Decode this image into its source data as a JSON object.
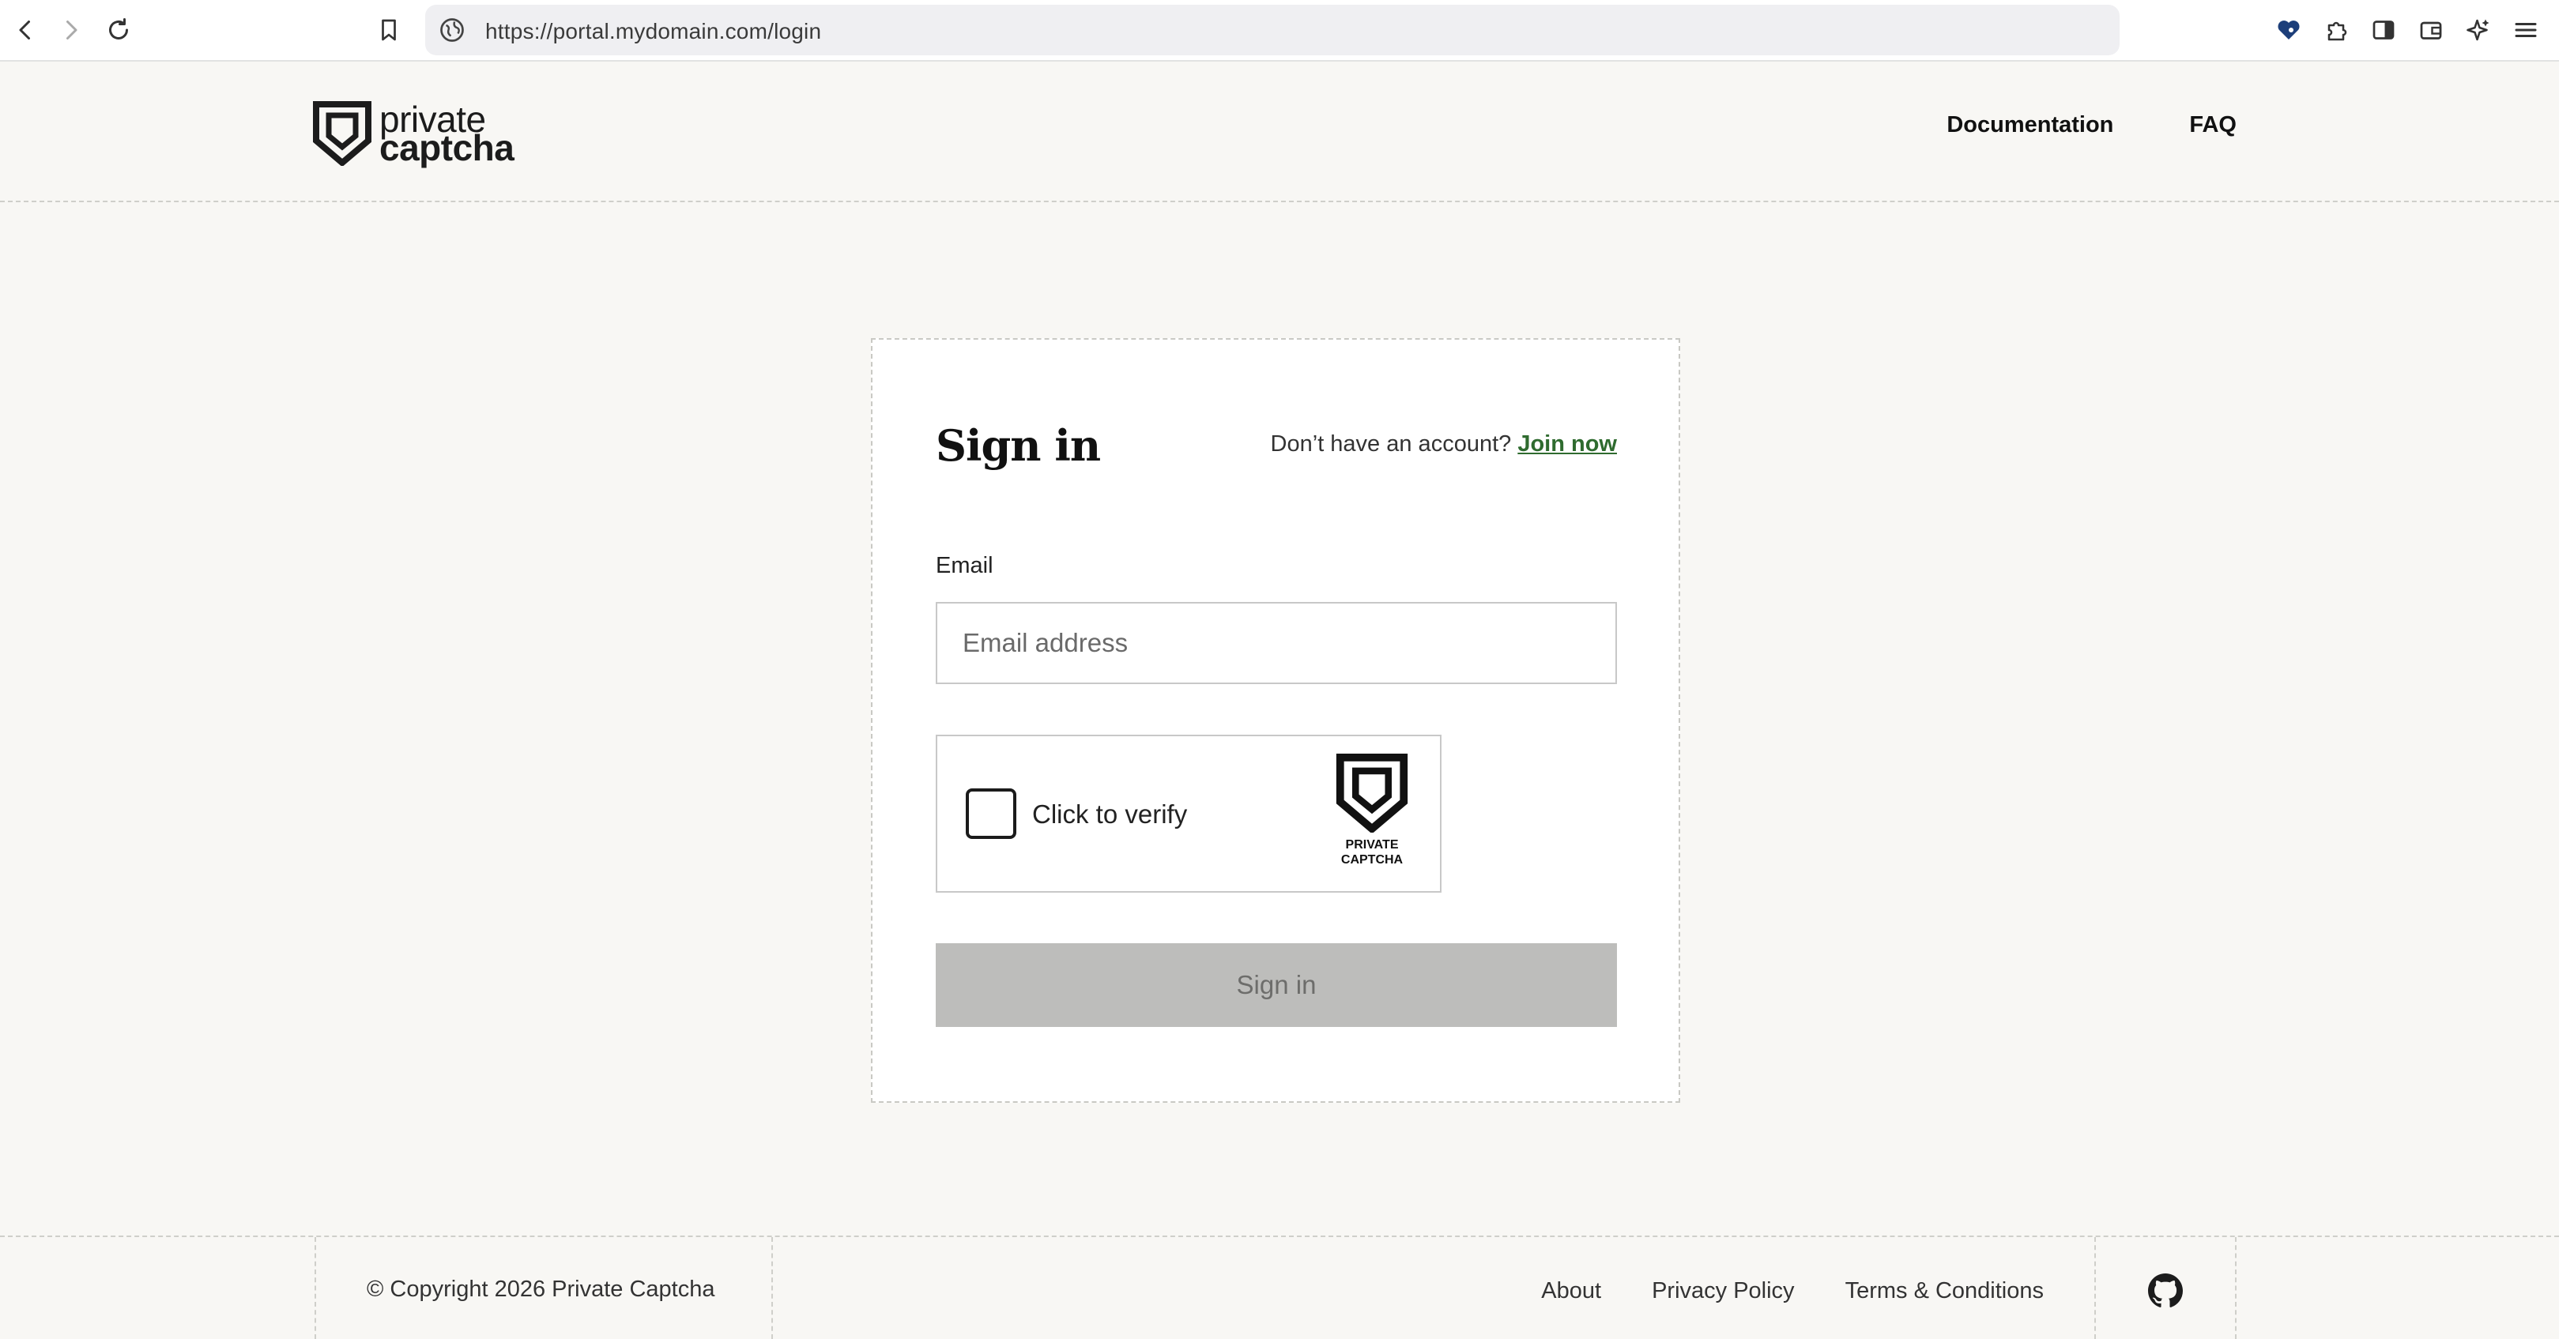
{
  "browser": {
    "url": "https://portal.mydomain.com/login"
  },
  "header": {
    "logo_line1": "private",
    "logo_line2": "captcha",
    "nav": {
      "documentation": "Documentation",
      "faq": "FAQ"
    }
  },
  "signin": {
    "title": "Sign in",
    "no_account": "Don’t have an account?",
    "join_now": "Join now",
    "email_label": "Email",
    "email_placeholder": "Email address",
    "email_value": "",
    "captcha_label": "Click to verify",
    "captcha_brand_line1": "PRIVATE",
    "captcha_brand_line2": "CAPTCHA",
    "captcha_checked": false,
    "submit_label": "Sign in",
    "submit_enabled": false
  },
  "footer": {
    "copyright": "© Copyright 2026 Private Captcha",
    "links": {
      "about": "About",
      "privacy": "Privacy Policy",
      "terms": "Terms & Conditions"
    }
  },
  "icons": {
    "back": "back-arrow-icon",
    "forward": "forward-arrow-icon",
    "reload": "reload-icon",
    "bookmark": "bookmark-icon",
    "site_info": "globe-icon",
    "github": "github-icon"
  },
  "colors": {
    "page_background": "#f8f7f4",
    "join_link": "#2f6b2f",
    "disabled_button": "#bdbdbb"
  }
}
